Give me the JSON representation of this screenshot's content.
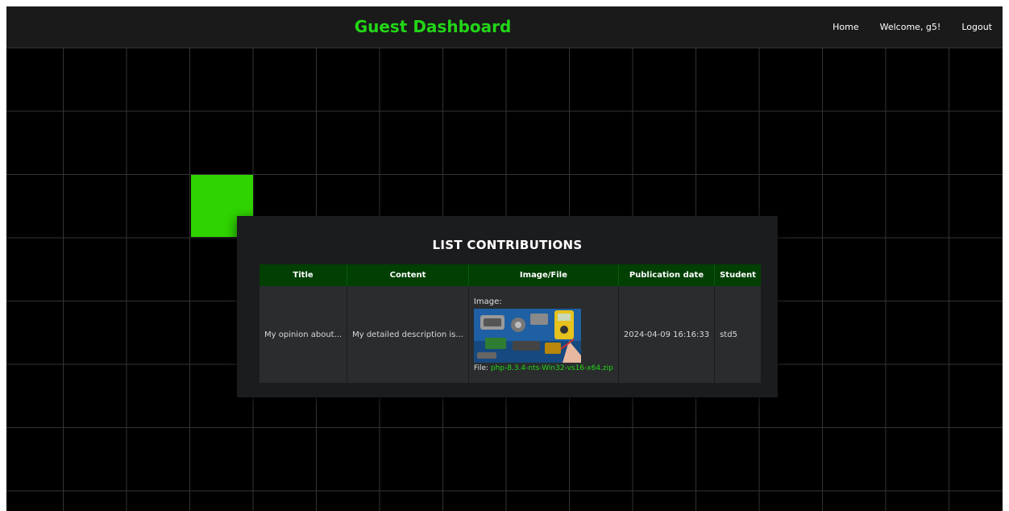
{
  "header": {
    "title": "Guest Dashboard",
    "nav": {
      "home": "Home",
      "welcome": "Welcome, g5!",
      "logout": "Logout"
    }
  },
  "panel": {
    "title": "LIST CONTRIBUTIONS",
    "table": {
      "headers": [
        "Title",
        "Content",
        "Image/File",
        "Publication date",
        "Student"
      ],
      "rows": [
        {
          "title": "My opinion about...",
          "content": "My detailed description is...",
          "image_label": "Image:",
          "file_label": "File: ",
          "file_name": "php-8.3.4-nts-Win32-vs16-x64.zip",
          "publication_date": "2024-04-09 16:16:33",
          "student": "std5"
        }
      ]
    }
  },
  "colors": {
    "accent": "#22d616",
    "highlight_tile": "#2fd400",
    "table_header_bg": "#013f03"
  }
}
